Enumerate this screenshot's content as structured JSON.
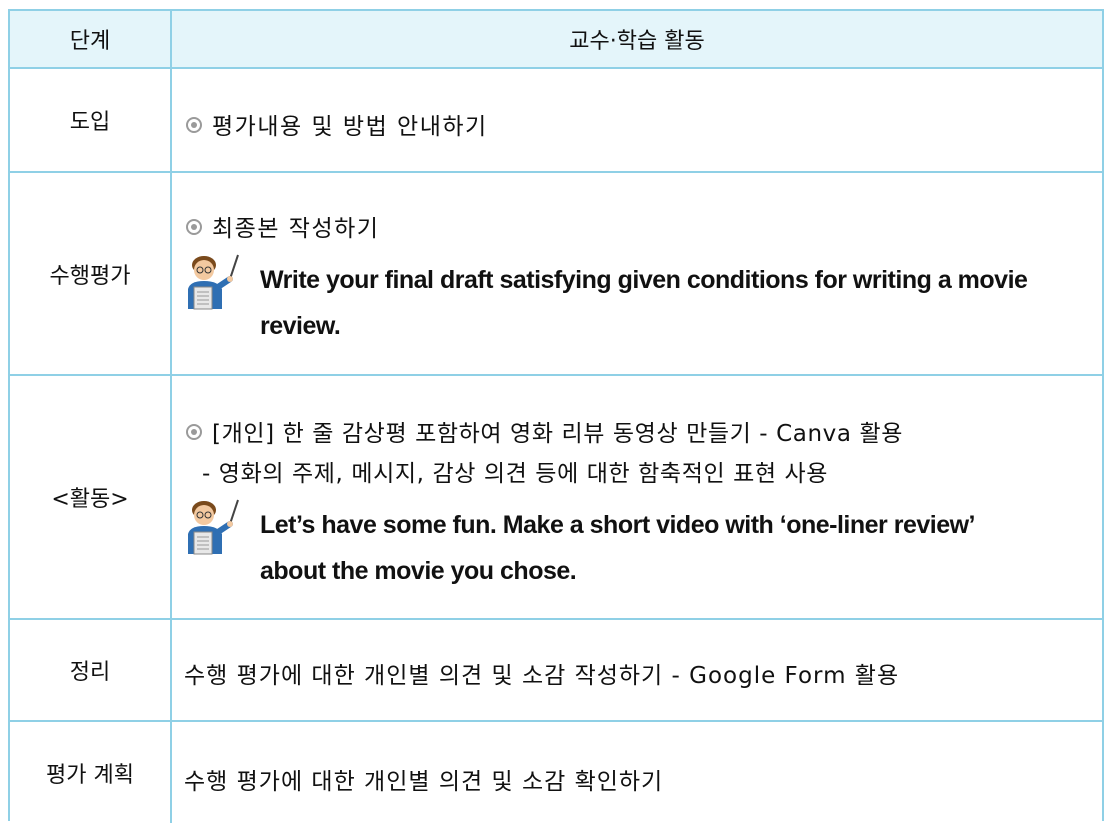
{
  "table": {
    "header": {
      "stage": "단계",
      "activity": "교수·학습 활동"
    },
    "rows": [
      {
        "stage": "도입",
        "bullet": "평가내용 및 방법 안내하기"
      },
      {
        "stage": "수행평가",
        "bullet": "최종본 작성하기",
        "instruction_line1": "Write your final draft satisfying given conditions for writing a movie",
        "instruction_line2": "review."
      },
      {
        "stage": "<활동>",
        "bullet": "[개인] 한 줄 감상평 포함하여 영화 리뷰 동영상 만들기 - Canva 활용",
        "sub": "- 영화의 주제, 메시지, 감상 의견 등에 대한 함축적인 표현 사용",
        "instruction_line1": "Let’s have some fun. Make a short video with ‘one-liner review’",
        "instruction_line2": "about the movie you chose."
      },
      {
        "stage": "정리",
        "text": "수행 평가에 대한 개인별 의견 및 소감 작성하기 - Google Form 활용"
      },
      {
        "stage": "평가 계획",
        "text": "수행 평가에 대한 개인별 의견 및 소감 확인하기"
      }
    ]
  },
  "icons": {
    "bullet": "circle-bullet-icon",
    "teacher": "teacher-pointer-icon"
  },
  "colors": {
    "border": "#8fd0e6",
    "header_bg": "#e4f5fa"
  }
}
